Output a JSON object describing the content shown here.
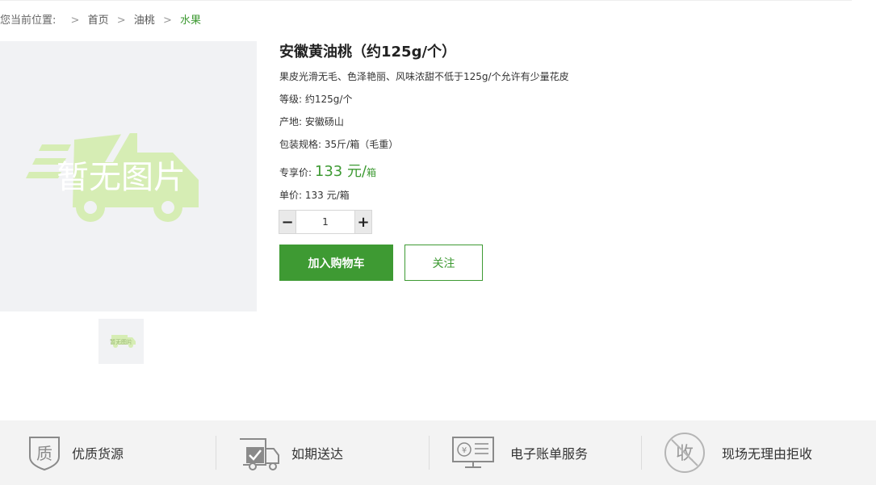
{
  "breadcrumb": {
    "prefix": "您当前位置:",
    "items": [
      {
        "label": "首页"
      },
      {
        "label": "油桃"
      }
    ],
    "current": "水果",
    "separator": ">"
  },
  "gallery": {
    "placeholder_text": "暂无图片",
    "thumb_text": "暂无图片"
  },
  "product": {
    "title": "安徽黄油桃（约125g/个）",
    "description": "果皮光滑无毛、色泽艳丽、风味浓甜不低于125g/个允许有少量花皮",
    "grade_label": "等级:",
    "grade_value": "约125g/个",
    "origin_label": "产地:",
    "origin_value": "安徽砀山",
    "pack_label": "包装规格:",
    "pack_value": "35斤/箱（毛重）",
    "special_price_label": "专享价:",
    "special_price_value": "133 元/",
    "special_price_unit": "箱",
    "unit_price_label": "单价:",
    "unit_price_value": "133 元/箱",
    "quantity": "1",
    "quantity_minus": "−",
    "quantity_plus": "+",
    "add_to_cart_label": "加入购物车",
    "follow_label": "关注"
  },
  "features": [
    {
      "label": "优质货源",
      "icon": "quality-badge-icon",
      "glyph": "质"
    },
    {
      "label": "如期送达",
      "icon": "delivery-truck-icon"
    },
    {
      "label": "电子账单服务",
      "icon": "e-bill-monitor-icon",
      "glyph": "¥"
    },
    {
      "label": "现场无理由拒收",
      "icon": "reject-receipt-icon",
      "glyph": "收"
    }
  ],
  "colors": {
    "accent": "#3e9a33",
    "placeholder_bg": "#f1f2f4",
    "footer_bg": "#f3f3f3"
  }
}
